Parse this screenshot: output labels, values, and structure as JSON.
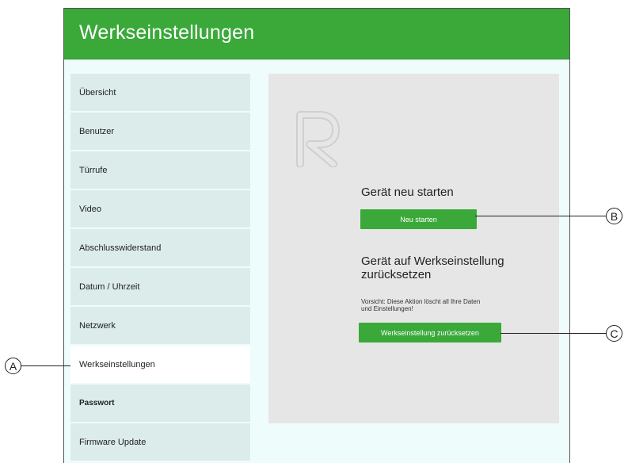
{
  "header": {
    "title": "Werkseinstellungen"
  },
  "sidebar": {
    "items": [
      {
        "label": "Übersicht"
      },
      {
        "label": "Benutzer"
      },
      {
        "label": "Türrufe"
      },
      {
        "label": "Video"
      },
      {
        "label": "Abschlusswiderstand"
      },
      {
        "label": "Datum / Uhrzeit"
      },
      {
        "label": "Netzwerk"
      },
      {
        "label": "Werkseinstellungen"
      },
      {
        "label": "Passwort"
      },
      {
        "label": "Firmware Update"
      }
    ],
    "active_index": 7
  },
  "main": {
    "restart": {
      "title": "Gerät neu starten",
      "button_label": "Neu starten"
    },
    "reset": {
      "title_line1": "Gerät auf Werkseinstellung",
      "title_line2": "zurücksetzen",
      "warning_line1": "Vorsicht: Diese Aktion löscht all Ihre Daten",
      "warning_line2": "und Einstellungen!",
      "button_label": "Werkseinstellung zurücksetzen"
    }
  },
  "callouts": {
    "a": "A",
    "b": "B",
    "c": "C"
  },
  "colors": {
    "brand_green": "#3aa93a",
    "page_bg": "#effcfc",
    "nav_bg": "#dbeceb",
    "panel_bg": "#e6e6e6"
  },
  "icons": {
    "logo": "r-logo-icon"
  }
}
